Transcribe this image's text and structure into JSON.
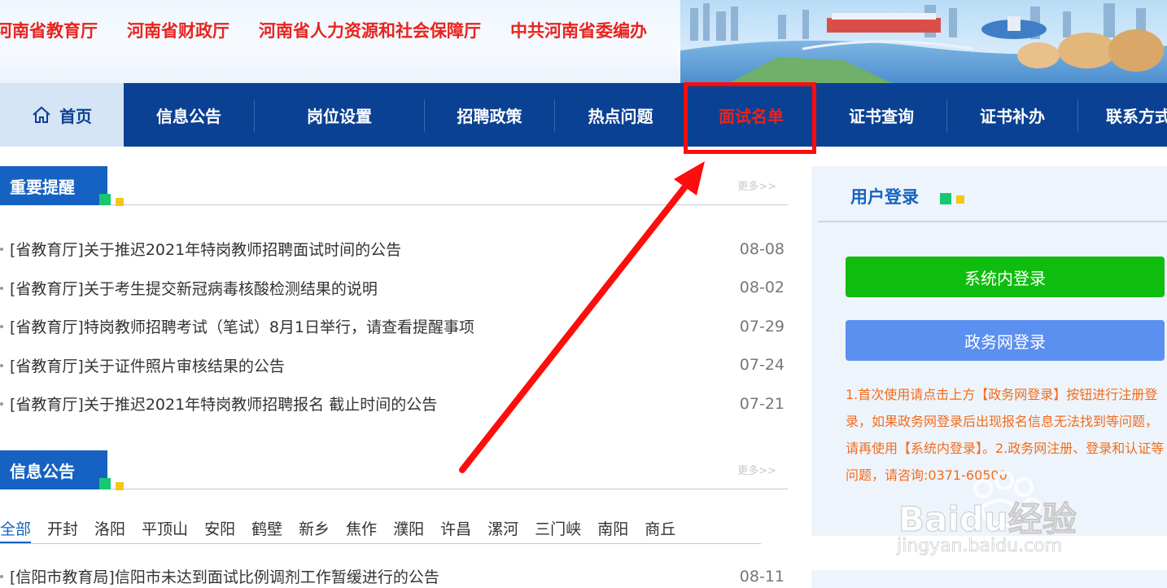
{
  "banner": {
    "links": [
      "河南省教育厅",
      "河南省财政厅",
      "河南省人力资源和社会保障厅",
      "中共河南省委编办"
    ]
  },
  "nav": {
    "home": "首页",
    "items": [
      "信息公告",
      "岗位设置",
      "招聘政策",
      "热点问题",
      "面试名单",
      "证书查询",
      "证书补办",
      "联系方式"
    ],
    "active": "面试名单"
  },
  "important": {
    "title": "重要提醒",
    "more": "更多>>",
    "items": [
      {
        "title": "[省教育厅]关于推迟2021年特岗教师招聘面试时间的公告",
        "date": "08-08"
      },
      {
        "title": "[省教育厅]关于考生提交新冠病毒核酸检测结果的说明",
        "date": "08-02"
      },
      {
        "title": "[省教育厅]特岗教师招聘考试（笔试）8月1日举行，请查看提醒事项",
        "date": "07-29"
      },
      {
        "title": "[省教育厅]关于证件照片审核结果的公告",
        "date": "07-24"
      },
      {
        "title": "[省教育厅]关于推迟2021年特岗教师招聘报名 截止时间的公告",
        "date": "07-21"
      }
    ]
  },
  "info": {
    "title": "信息公告",
    "more": "更多>>",
    "regions": [
      "全部",
      "开封",
      "洛阳",
      "平顶山",
      "安阳",
      "鹤壁",
      "新乡",
      "焦作",
      "濮阳",
      "许昌",
      "漯河",
      "三门峡",
      "南阳",
      "商丘"
    ],
    "items": [
      {
        "title": "[信阳市教育局]信阳市未达到面试比例调剂工作暂缓进行的公告",
        "date": "08-11"
      }
    ]
  },
  "login": {
    "title": "用户登录",
    "system_button": "系统内登录",
    "gov_button": "政务网登录",
    "notice": "1.首次使用请点击上方【政务网登录】按钮进行注册登录，如果政务网登录后出现报名信息无法找到等问题，请再使用【系统内登录】。2.政务网注册、登录和认证等问题，请咨询:0371-60500"
  },
  "watermark": {
    "brand": "Baidu经验",
    "url": "jingyan.baidu.com"
  },
  "colors": {
    "nav_bg": "#0b4193",
    "accent_red": "#e8231e",
    "section_blue": "#1662c2",
    "green_button": "#0fbd0f",
    "blue_button": "#5b8ff0",
    "notice_orange": "#f26c1d"
  }
}
